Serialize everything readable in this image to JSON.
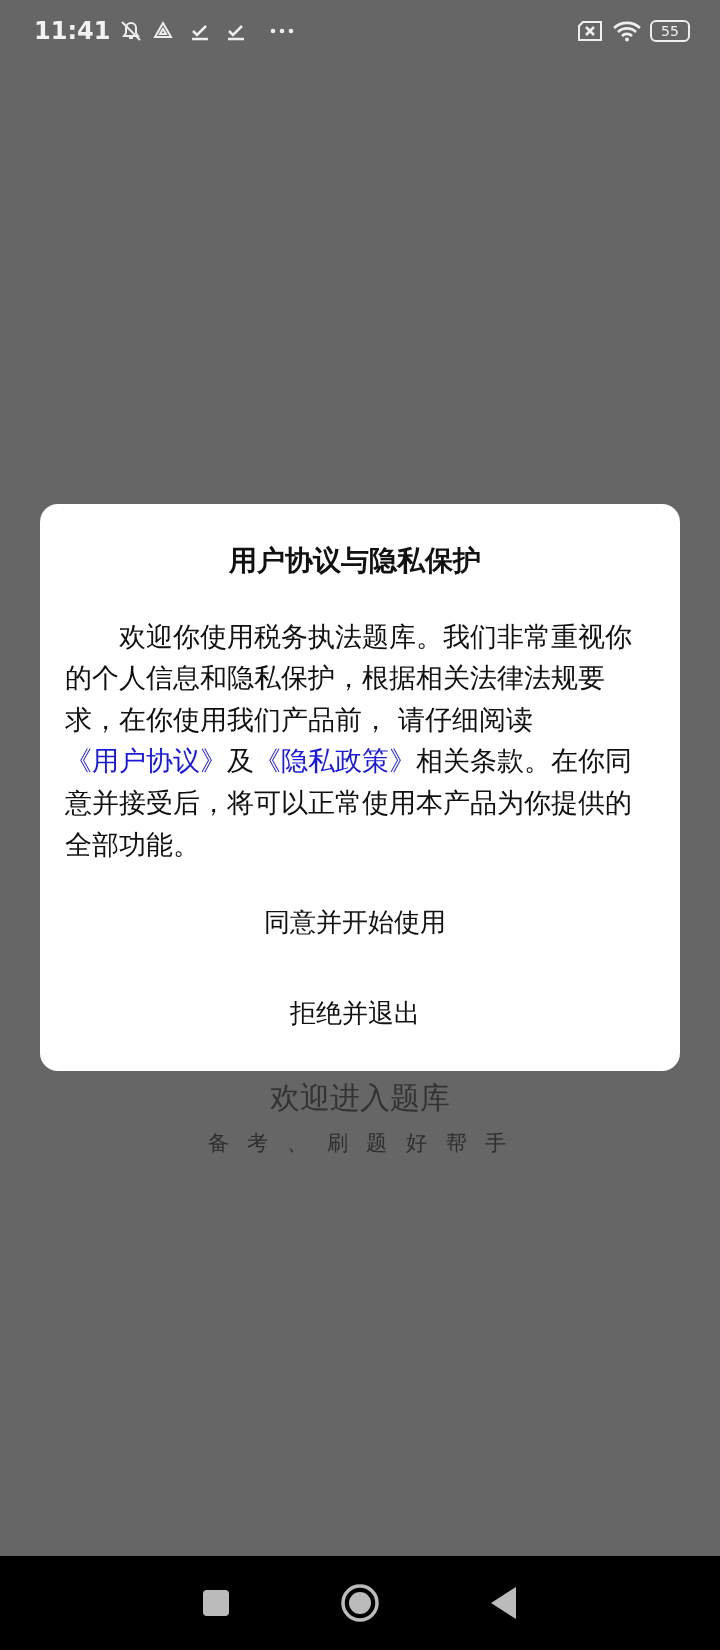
{
  "status_bar": {
    "time": "11:41",
    "battery": "55"
  },
  "background": {
    "title": "欢迎进入题库",
    "subtitle": "备 考 、 刷 题 好 帮 手"
  },
  "dialog": {
    "title": "用户协议与隐私保护",
    "body": [
      {
        "kind": "text",
        "text": "欢迎你使用税务执法题库。我们非常重视你的个人信息和隐私保护，根据相关法律法规要求，在你使用我们产品前， 请仔细阅读"
      },
      {
        "kind": "link",
        "text": "《用户协议》"
      },
      {
        "kind": "text",
        "text": "及"
      },
      {
        "kind": "link",
        "text": "《隐私政策》"
      },
      {
        "kind": "text",
        "text": "相关条款。在你同意并接受后，将可以正常使用本产品为你提供的全部功能。"
      }
    ],
    "buttons": [
      "同意并开始使用",
      "拒绝并退出"
    ]
  }
}
